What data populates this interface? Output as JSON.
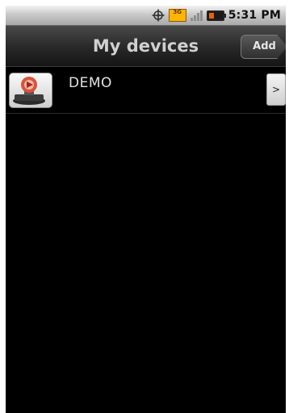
{
  "status_bar": {
    "time": "5:31 PM",
    "network_label": "3G",
    "icons": [
      "gps-icon",
      "network-3g-icon",
      "signal-icon",
      "battery-icon"
    ],
    "battery_level": 0.35
  },
  "title_bar": {
    "title": "My devices",
    "add_label": "Add"
  },
  "devices": [
    {
      "name": "DEMO",
      "icon": "device-icon",
      "chevron": ">"
    }
  ],
  "colors": {
    "background": "#000000",
    "title_text": "#d0d0d0",
    "battery": "#e8630a"
  }
}
